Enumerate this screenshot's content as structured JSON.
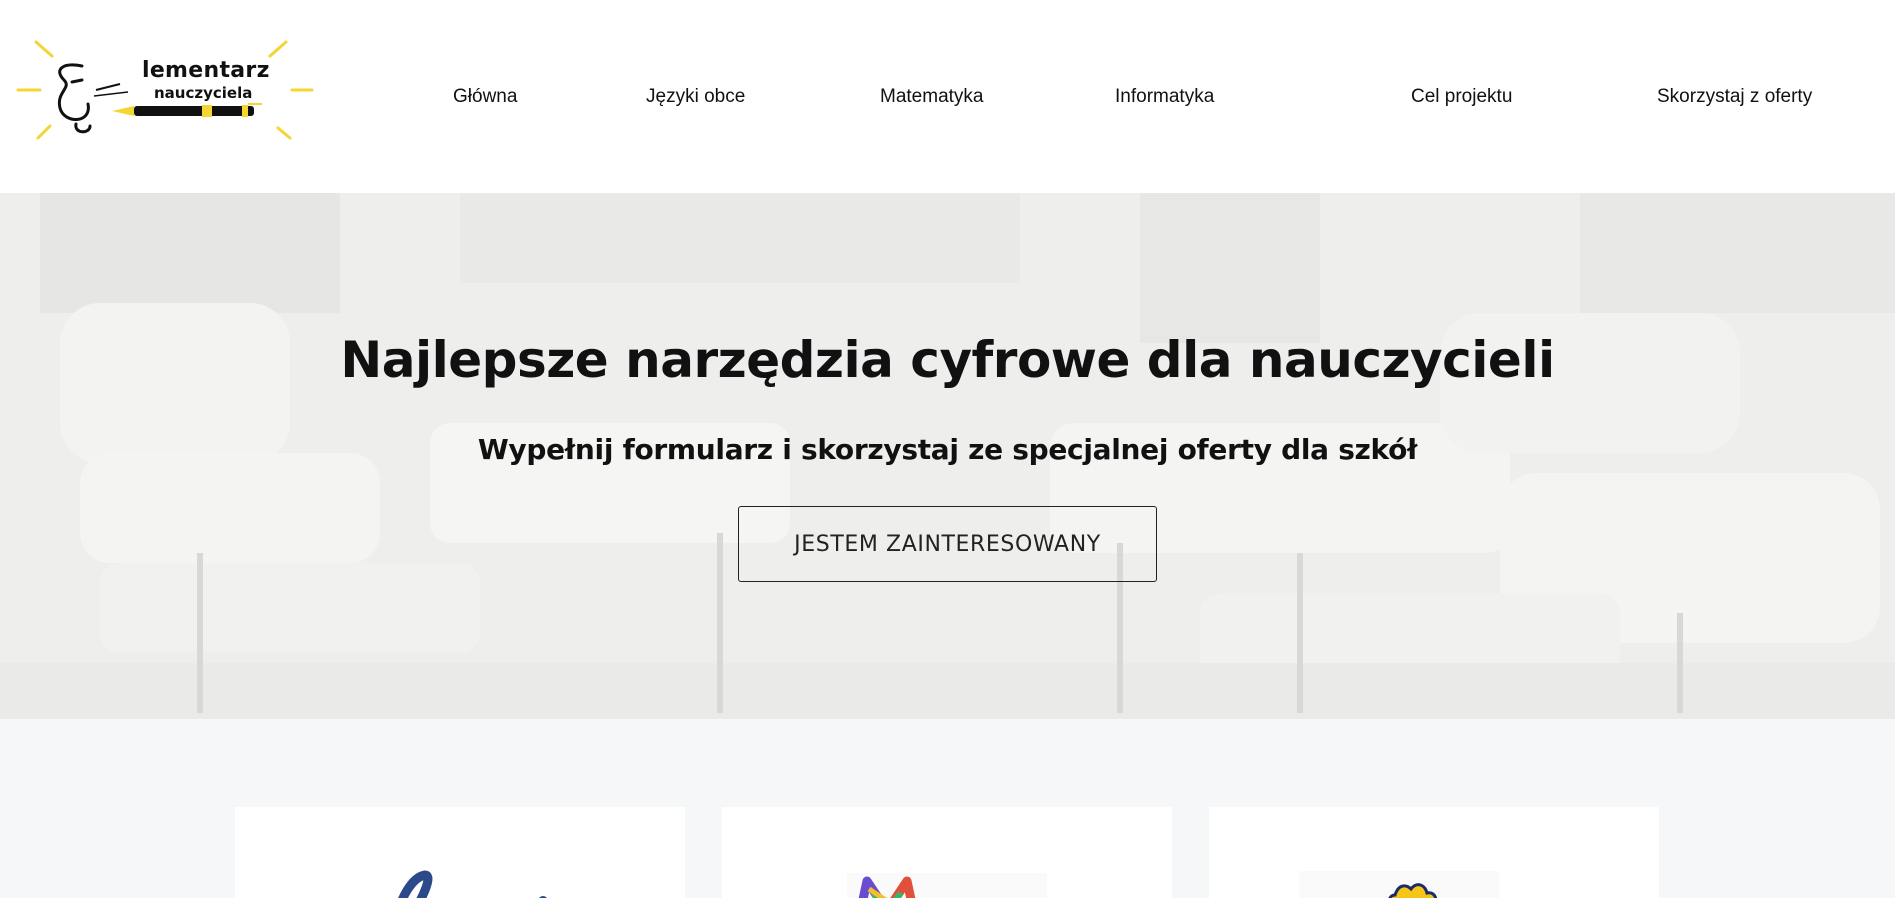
{
  "header": {
    "logo": {
      "line1": "lementarz",
      "line2": "nauczyciela",
      "icon": "pen-logo-icon"
    },
    "nav": [
      {
        "label": "Główna"
      },
      {
        "label": "Języki obce"
      },
      {
        "label": "Matematyka"
      },
      {
        "label": "Informatyka"
      },
      {
        "label": "Cel projektu"
      },
      {
        "label": "Skorzystaj z oferty"
      }
    ]
  },
  "hero": {
    "title": "Najlepsze narzędzia cyfrowe dla nauczycieli",
    "subtitle": "Wypełnij formularz i skorzystaj ze specjalnej oferty dla szkół",
    "cta_label": "JESTEM ZAINTERESOWANY"
  },
  "cards": [
    {
      "icon": "script-logo-icon"
    },
    {
      "icon": "colorful-m-logo-icon"
    },
    {
      "icon": "yellow-badge-logo-icon"
    }
  ],
  "colors": {
    "accent_yellow": "#f5d533",
    "cards_background": "#f6f7f9",
    "text": "#111111"
  }
}
